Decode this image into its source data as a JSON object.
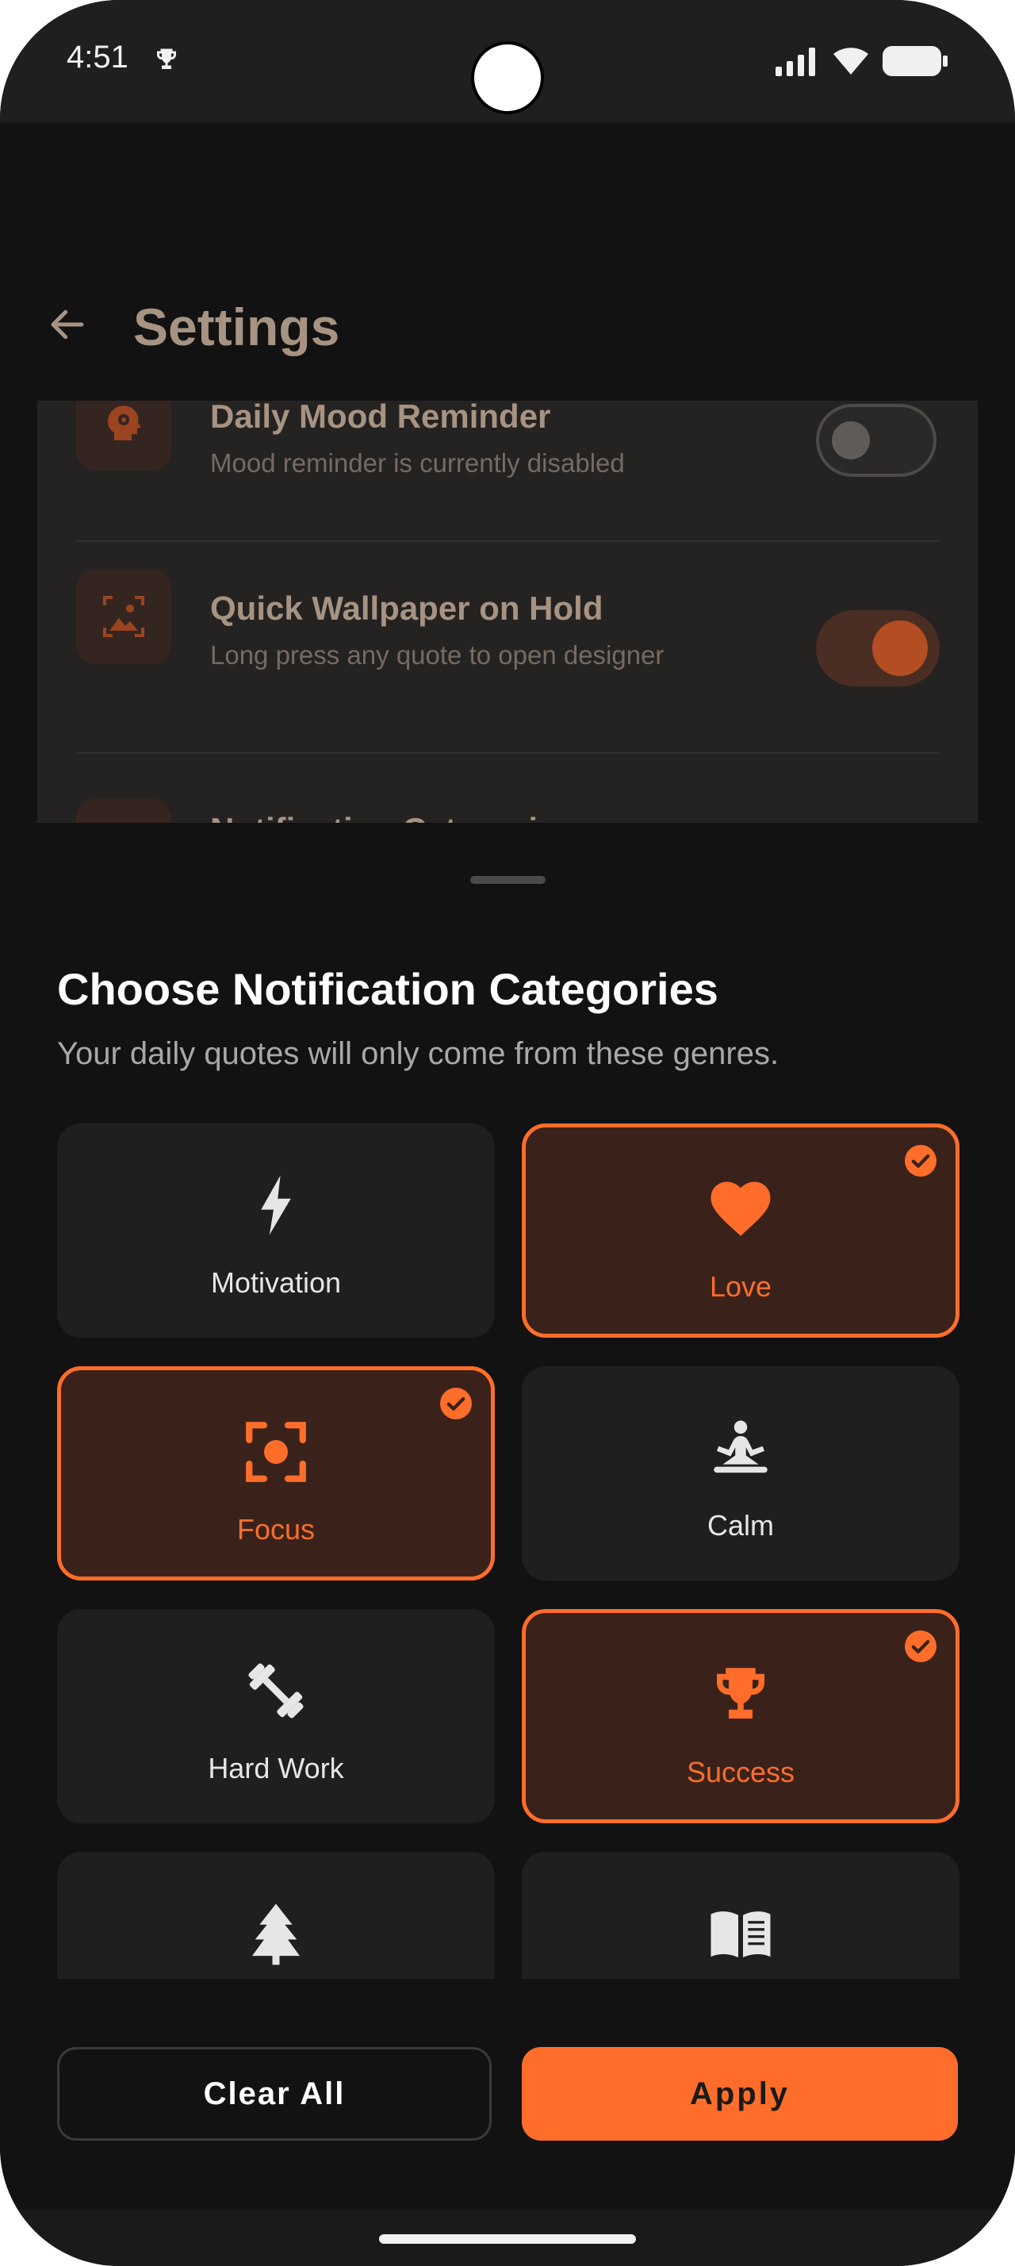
{
  "status_bar": {
    "time": "4:51",
    "icons": [
      "trophy-icon",
      "signal-icon",
      "wifi-icon",
      "battery-icon"
    ]
  },
  "header": {
    "title": "Settings",
    "back_icon": "arrow-left-icon"
  },
  "settings_rows": [
    {
      "title": "Daily Mood Reminder",
      "subtitle": "Mood reminder is currently disabled",
      "toggle_on": false,
      "icon": "head-gear-icon"
    },
    {
      "title": "Quick Wallpaper on Hold",
      "subtitle": "Long press any quote to open designer",
      "toggle_on": true,
      "icon": "image-frame-icon"
    },
    {
      "title": "Notification Categories",
      "icon": "category-icon"
    }
  ],
  "sheet": {
    "title": "Choose Notification Categories",
    "subtitle": "Your daily quotes will only come from these genres.",
    "categories": [
      {
        "label": "Motivation",
        "icon": "bolt-icon",
        "selected": false
      },
      {
        "label": "Love",
        "icon": "heart-icon",
        "selected": true
      },
      {
        "label": "Focus",
        "icon": "focus-icon",
        "selected": true
      },
      {
        "label": "Calm",
        "icon": "meditation-icon",
        "selected": false
      },
      {
        "label": "Hard Work",
        "icon": "dumbbell-icon",
        "selected": false
      },
      {
        "label": "Success",
        "icon": "trophy-icon",
        "selected": true
      },
      {
        "label": "",
        "icon": "tree-icon",
        "selected": false
      },
      {
        "label": "",
        "icon": "book-icon",
        "selected": false
      }
    ],
    "clear_label": "Clear All",
    "apply_label": "Apply"
  },
  "colors": {
    "accent": "#ff6d2a",
    "background": "#121212",
    "tile": "#1f1f1f",
    "tile_selected": "#3a221b"
  }
}
